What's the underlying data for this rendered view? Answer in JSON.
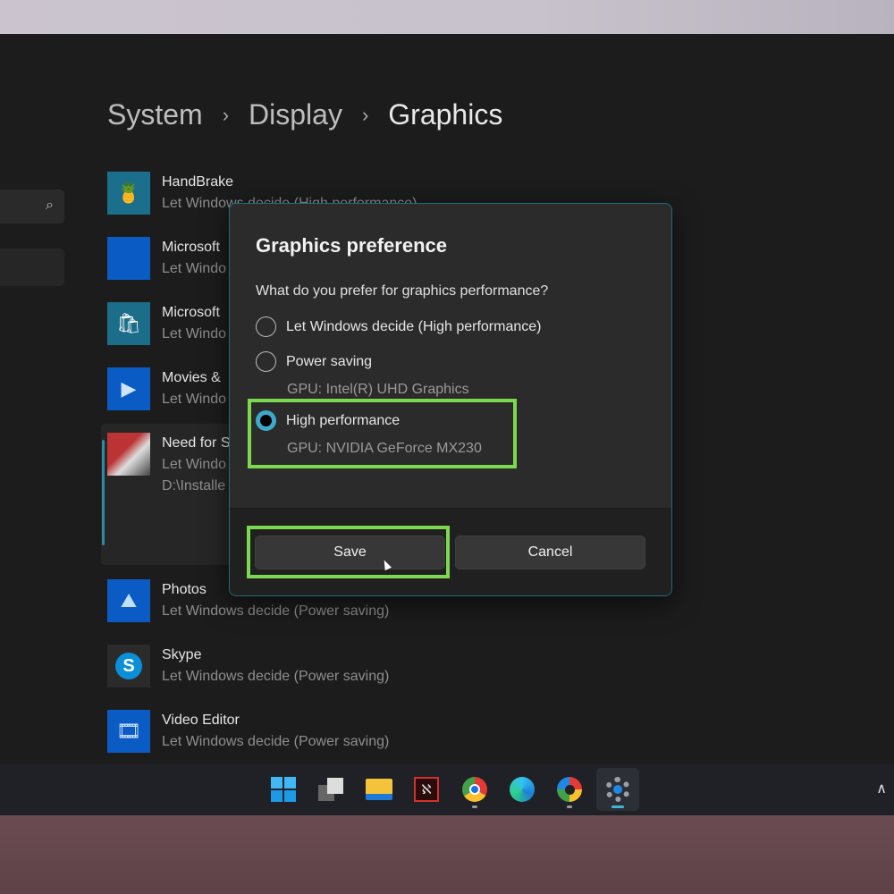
{
  "breadcrumb": [
    "System",
    "Display",
    "Graphics"
  ],
  "search_icon": "search-icon",
  "apps": [
    {
      "name": "HandBrake",
      "pref": "Let Windows decide (High performance)",
      "icon": "handbrake-icon"
    },
    {
      "name": "Microsoft",
      "pref": "Let Windo",
      "icon": "microsoft-app-icon"
    },
    {
      "name": "Microsoft",
      "pref": "Let Windo",
      "icon": "microsoft-store-icon"
    },
    {
      "name": "Movies &",
      "pref": "Let Windo",
      "icon": "movies-tv-icon"
    },
    {
      "name": "Need for S",
      "pref": "Let Windo",
      "path": "D:\\Installe",
      "icon": "need-for-speed-icon"
    },
    {
      "name": "Photos",
      "pref": "Let Windows decide (Power saving)",
      "icon": "photos-icon"
    },
    {
      "name": "Skype",
      "pref": "Let Windows decide (Power saving)",
      "icon": "skype-icon"
    },
    {
      "name": "Video Editor",
      "pref": "Let Windows decide (Power saving)",
      "icon": "video-editor-icon"
    }
  ],
  "dialog": {
    "title": "Graphics preference",
    "question": "What do you prefer for graphics performance?",
    "options": [
      {
        "label": "Let Windows decide (High performance)",
        "selected": false
      },
      {
        "label": "Power saving",
        "gpu": "GPU: Intel(R) UHD Graphics",
        "selected": false
      },
      {
        "label": "High performance",
        "gpu": "GPU: NVIDIA GeForce MX230",
        "selected": true
      }
    ],
    "save": "Save",
    "cancel": "Cancel"
  },
  "highlight_color": "#7cd84f",
  "accent_color": "#3fa9c9",
  "taskbar": [
    "start",
    "task-view",
    "file-explorer",
    "adobe-acrobat",
    "chrome",
    "edge",
    "chrome-canary",
    "settings"
  ]
}
